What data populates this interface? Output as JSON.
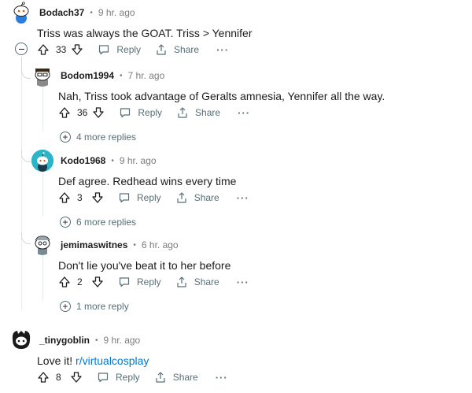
{
  "comments": [
    {
      "author": "Bodach37",
      "time": "9 hr. ago",
      "text": "Triss was always the GOAT. Triss > Yennifer",
      "votes": "33",
      "reply_label": "Reply",
      "share_label": "Share",
      "more_label": "···",
      "avatar_color": "#c5e3f2"
    },
    {
      "author": "Bodom1994",
      "time": "7 hr. ago",
      "text": "Nah, Triss took advantage of Geralts amnesia, Yennifer all the way.",
      "votes": "36",
      "reply_label": "Reply",
      "share_label": "Share",
      "more_label": "···",
      "more_replies": "4 more replies",
      "avatar_color": "#f6f6f6"
    },
    {
      "author": "Kodo1968",
      "time": "9 hr. ago",
      "text": "Def agree. Redhead wins every time",
      "votes": "3",
      "reply_label": "Reply",
      "share_label": "Share",
      "more_label": "···",
      "more_replies": "6 more replies",
      "avatar_color": "#2ab5c8"
    },
    {
      "author": "jemimaswitnes",
      "time": "6 hr. ago",
      "text": "Don't lie you've beat it to her before",
      "votes": "2",
      "reply_label": "Reply",
      "share_label": "Share",
      "more_label": "···",
      "more_replies": "1 more reply",
      "avatar_color": "#f0f0f0"
    },
    {
      "author": "_tinygoblin",
      "time": "9 hr. ago",
      "text_prefix": "Love it! ",
      "link": "r/virtualcosplay",
      "votes": "8",
      "reply_label": "Reply",
      "share_label": "Share",
      "more_label": "···",
      "avatar_color": "#1a1a1a"
    }
  ],
  "separator": "•",
  "colors": {
    "link": "#0079d3",
    "meta_gray": "#7c7c7c",
    "action_gray": "#576f76",
    "thread_line": "#e5ebee"
  },
  "icons": [
    "upvote-icon",
    "downvote-icon",
    "reply-icon",
    "share-icon",
    "more-icon",
    "collapse-icon",
    "expand-icon"
  ]
}
